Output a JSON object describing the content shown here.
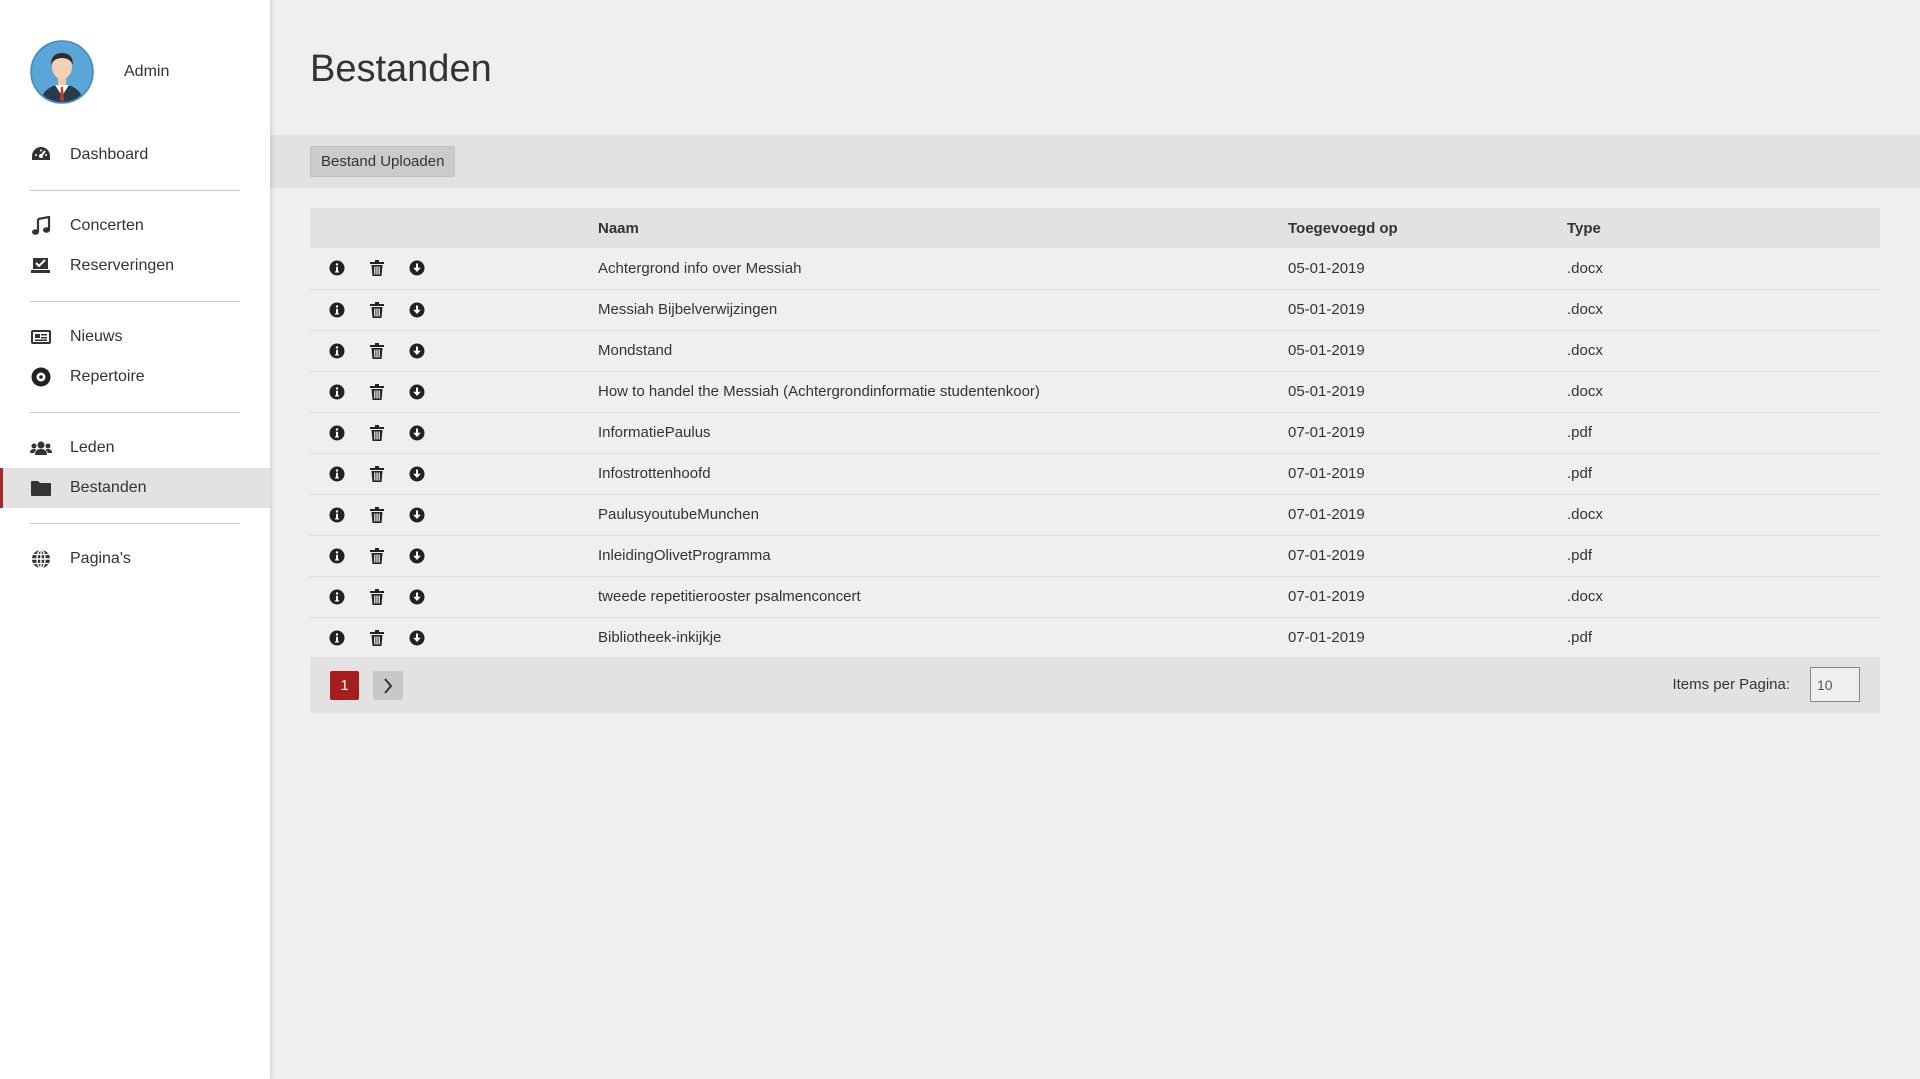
{
  "sidebar": {
    "user_name": "Admin",
    "items": [
      {
        "label": "Dashboard",
        "icon": "dashboard-icon"
      },
      {
        "label": "Concerten",
        "icon": "music-icon"
      },
      {
        "label": "Reserveringen",
        "icon": "reservations-icon"
      },
      {
        "label": "Nieuws",
        "icon": "newspaper-icon"
      },
      {
        "label": "Repertoire",
        "icon": "record-icon"
      },
      {
        "label": "Leden",
        "icon": "users-icon"
      },
      {
        "label": "Bestanden",
        "icon": "folder-icon",
        "active": true
      },
      {
        "label": "Pagina's",
        "icon": "globe-icon"
      }
    ]
  },
  "main": {
    "title": "Bestanden",
    "upload_label": "Bestand Uploaden",
    "columns": [
      "Naam",
      "Toegevoegd op",
      "Type"
    ],
    "rows": [
      {
        "name": "Achtergrond info over Messiah",
        "date": "05-01-2019",
        "type": ".docx"
      },
      {
        "name": "Messiah Bijbelverwijzingen",
        "date": "05-01-2019",
        "type": ".docx"
      },
      {
        "name": "Mondstand",
        "date": "05-01-2019",
        "type": ".docx"
      },
      {
        "name": "How to handel the Messiah (Achtergrondinformatie studentenkoor)",
        "date": "05-01-2019",
        "type": ".docx"
      },
      {
        "name": "InformatiePaulus",
        "date": "07-01-2019",
        "type": ".pdf"
      },
      {
        "name": "Infostrottenhoofd",
        "date": "07-01-2019",
        "type": ".pdf"
      },
      {
        "name": "PaulusyoutubeMunchen",
        "date": "07-01-2019",
        "type": ".docx"
      },
      {
        "name": "InleidingOlivetProgramma",
        "date": "07-01-2019",
        "type": ".pdf"
      },
      {
        "name": "tweede repetitierooster psalmenconcert",
        "date": "07-01-2019",
        "type": ".docx"
      },
      {
        "name": "Bibliotheek-inkijkje",
        "date": "07-01-2019",
        "type": ".pdf"
      }
    ],
    "pagination": {
      "current_page": "1",
      "items_per_page_label": "Items per Pagina:",
      "items_per_page": "10"
    }
  },
  "colors": {
    "accent": "#a51d1d",
    "sidebar_bg": "#ffffff",
    "page_bg": "#efefef",
    "bar_bg": "#e2e2e2"
  }
}
